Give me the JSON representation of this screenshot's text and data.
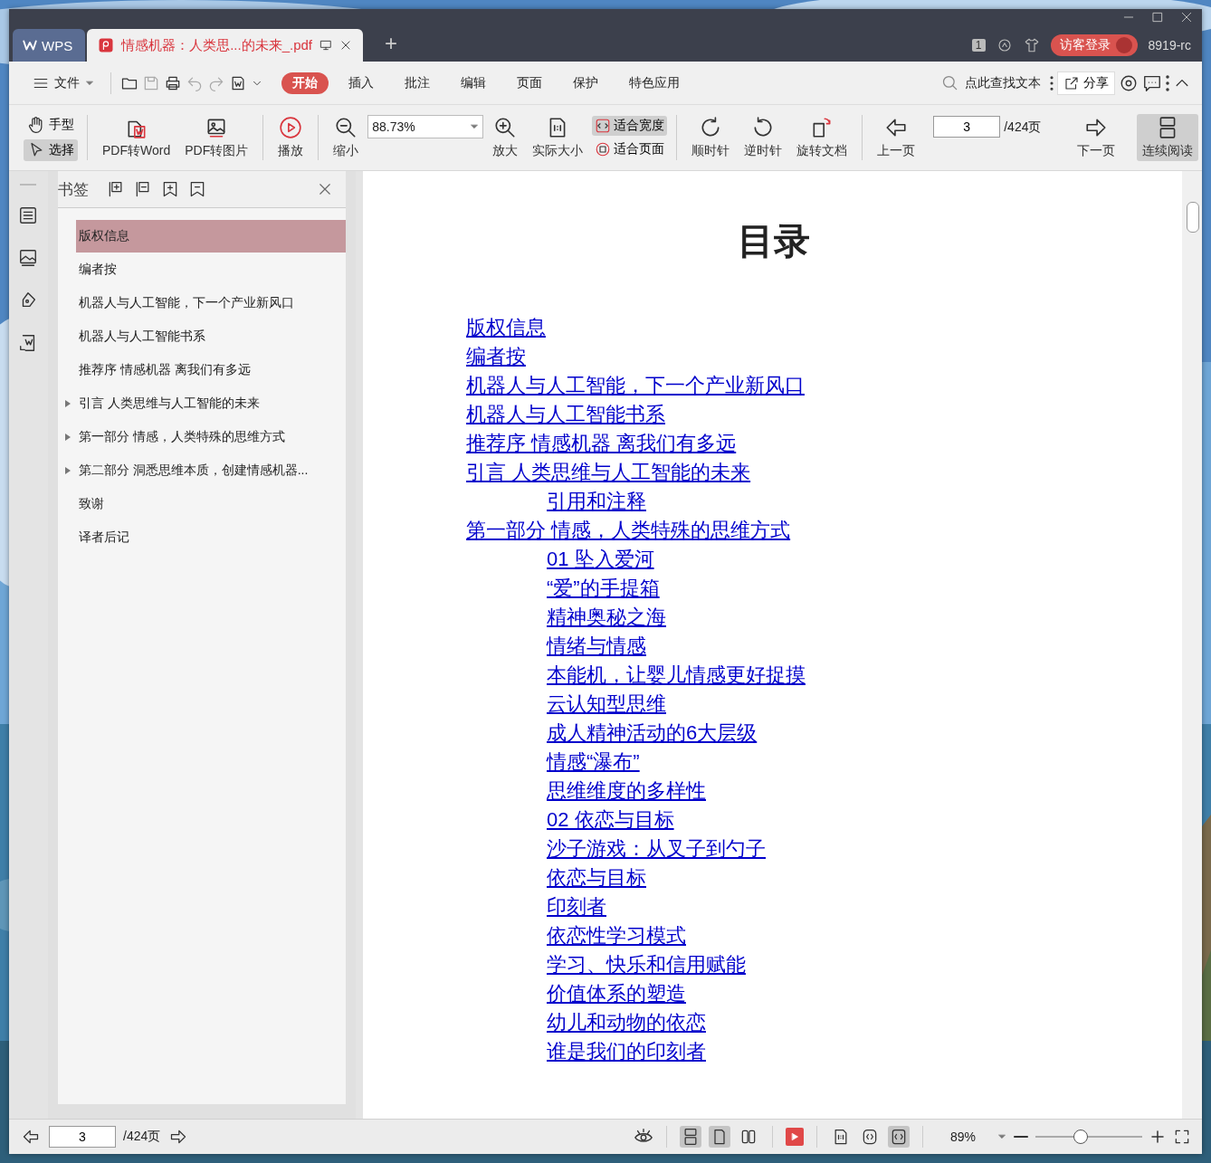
{
  "tabs": [
    {
      "label": "WPS",
      "kind": "home",
      "selected": false
    },
    {
      "label": "情感机器：人类思...的未来_.pdf",
      "kind": "doc",
      "selected": true
    }
  ],
  "title_bar": {
    "new_tab": "+",
    "page_badge": "1",
    "login": "访客登录",
    "user": "8919-rc"
  },
  "menu": {
    "file": "文件",
    "ribbon_tabs": [
      {
        "label": "开始",
        "selected": true
      },
      {
        "label": "插入",
        "selected": false
      },
      {
        "label": "批注",
        "selected": false
      },
      {
        "label": "编辑",
        "selected": false
      },
      {
        "label": "页面",
        "selected": false
      },
      {
        "label": "保护",
        "selected": false
      },
      {
        "label": "特色应用",
        "selected": false
      }
    ],
    "search": "点此查找文本",
    "share": "分享"
  },
  "toolbar": {
    "modes": [
      {
        "label": "手型",
        "kind": "hand",
        "selected": false
      },
      {
        "label": "选择",
        "kind": "pointer",
        "selected": true
      }
    ],
    "pdf_to_word": "PDF转Word",
    "pdf_to_image": "PDF转图片",
    "play": "播放",
    "zoom_out": "缩小",
    "zoom_value": "88.73%",
    "zoom_in": "放大",
    "actual_size": "实际大小",
    "fit": [
      {
        "label": "适合宽度",
        "kind": "width",
        "selected": true
      },
      {
        "label": "适合页面",
        "kind": "page",
        "selected": false
      }
    ],
    "rotate_cw": "顺时针",
    "rotate_ccw": "逆时针",
    "rotate_doc": "旋转文档",
    "prev_page": "上一页",
    "page": "3",
    "page_total": "/424页",
    "next_page": "下一页",
    "continuous": {
      "label": "连续阅读",
      "selected": true
    }
  },
  "bookmarks": {
    "title": "书签",
    "items": [
      {
        "label": "版权信息",
        "expandable": false,
        "selected": true
      },
      {
        "label": "编者按",
        "expandable": false,
        "selected": false
      },
      {
        "label": "机器人与人工智能，下一个产业新风口",
        "expandable": false,
        "selected": false
      },
      {
        "label": "机器人与人工智能书系",
        "expandable": false,
        "selected": false
      },
      {
        "label": "推荐序 情感机器 离我们有多远",
        "expandable": false,
        "selected": false
      },
      {
        "label": "引言 人类思维与人工智能的未来",
        "expandable": true,
        "selected": false
      },
      {
        "label": "第一部分 情感，人类特殊的思维方式",
        "expandable": true,
        "selected": false
      },
      {
        "label": "第二部分 洞悉思维本质，创建情感机器...",
        "expandable": true,
        "selected": false
      },
      {
        "label": "致谢",
        "expandable": false,
        "selected": false
      },
      {
        "label": "译者后记",
        "expandable": false,
        "selected": false
      }
    ]
  },
  "document": {
    "heading": "目录",
    "toc": [
      {
        "text": "版权信息"
      },
      {
        "text": "编者按"
      },
      {
        "text": "机器人与人工智能，下一个产业新风口"
      },
      {
        "text": "机器人与人工智能书系"
      },
      {
        "text": "推荐序 情感机器 离我们有多远"
      },
      {
        "text": "引言 人类思维与人工智能的未来",
        "children": [
          {
            "text": "引用和注释"
          }
        ]
      },
      {
        "text": "第一部分 情感，人类特殊的思维方式",
        "children": [
          {
            "text": "01 坠入爱河"
          },
          {
            "text": "“爱”的手提箱"
          },
          {
            "text": "精神奥秘之海"
          },
          {
            "text": "情绪与情感"
          },
          {
            "text": "本能机，让婴儿情感更好捉摸"
          },
          {
            "text": "云认知型思维"
          },
          {
            "text": "成人精神活动的6大层级"
          },
          {
            "text": "情感“瀑布”"
          },
          {
            "text": "思维维度的多样性"
          },
          {
            "text": "02 依恋与目标"
          },
          {
            "text": "沙子游戏：从叉子到勺子"
          },
          {
            "text": "依恋与目标"
          },
          {
            "text": "印刻者"
          },
          {
            "text": "依恋性学习模式"
          },
          {
            "text": "学习、快乐和信用赋能"
          },
          {
            "text": "价值体系的塑造"
          },
          {
            "text": "幼儿和动物的依恋"
          },
          {
            "text": "谁是我们的印刻者"
          }
        ]
      }
    ]
  },
  "status_bar": {
    "page": "3",
    "page_total": "/424页",
    "views": [
      {
        "kind": "continuous",
        "selected": true
      },
      {
        "kind": "single",
        "selected": true
      },
      {
        "kind": "double",
        "selected": false
      }
    ],
    "fits": [
      {
        "kind": "actual",
        "selected": false
      },
      {
        "kind": "page",
        "selected": false
      },
      {
        "kind": "width",
        "selected": true
      }
    ],
    "zoom": "89%",
    "level": 0.42
  }
}
